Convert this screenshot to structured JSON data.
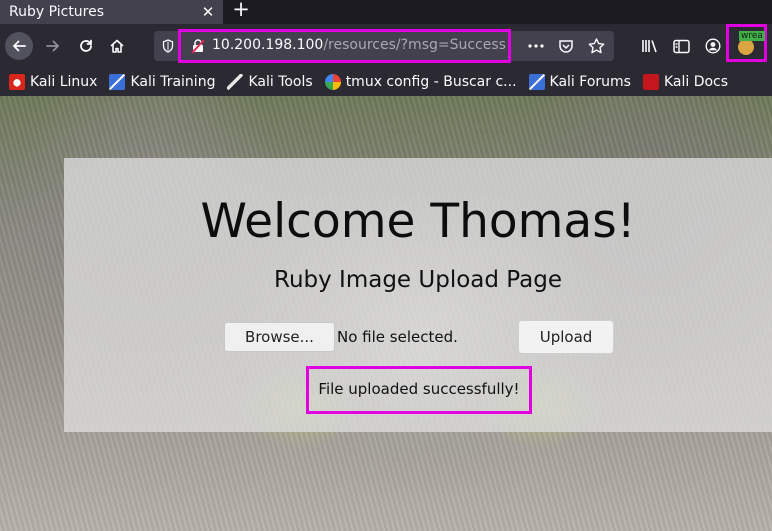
{
  "tab": {
    "title": "Ruby Pictures",
    "close": "✕",
    "new_tab": "+"
  },
  "urlbar": {
    "host": "10.200.198.100",
    "path": "/resources/?msg=Success"
  },
  "extension": {
    "badge": "wrea"
  },
  "bookmarks": [
    {
      "label": "Kali Linux",
      "color": "#d9261c"
    },
    {
      "label": "Kali Training",
      "color": "#3a6fd8"
    },
    {
      "label": "Kali Tools",
      "color": "#2b2a33"
    },
    {
      "label": "tmux config - Buscar c...",
      "color": "#ffffff"
    },
    {
      "label": "Kali Forums",
      "color": "#3a6fd8"
    },
    {
      "label": "Kali Docs",
      "color": "#c4161c"
    }
  ],
  "page": {
    "welcome": "Welcome Thomas!",
    "subtitle": "Ruby Image Upload Page",
    "browse_label": "Browse...",
    "file_status": "No file selected.",
    "upload_label": "Upload",
    "message": "File uploaded successfully!"
  },
  "colors": {
    "highlight": "#e000e0"
  }
}
